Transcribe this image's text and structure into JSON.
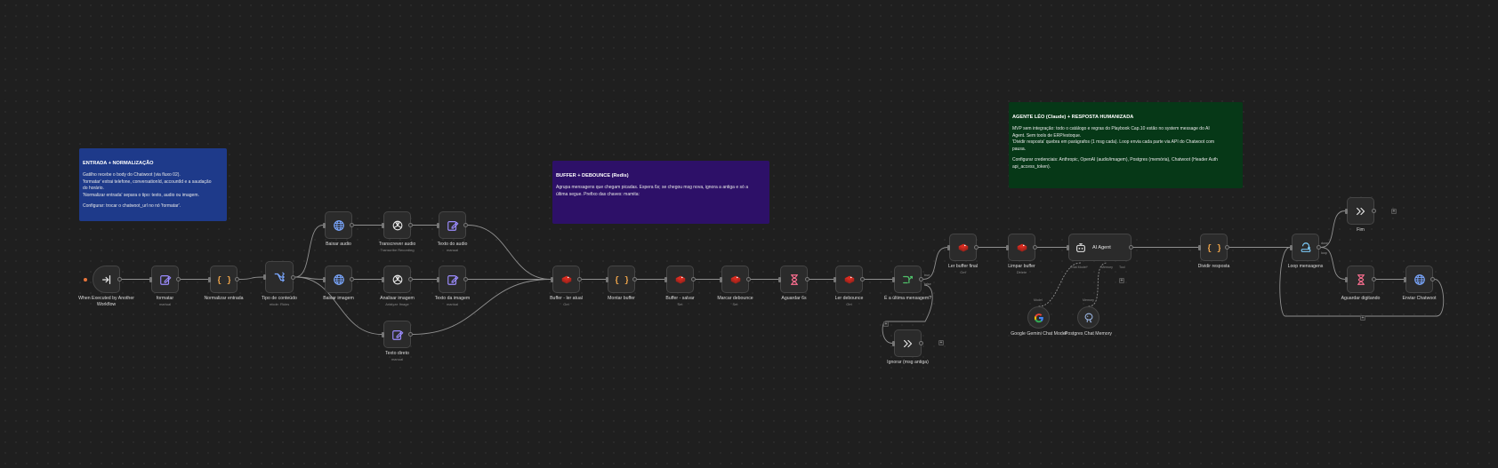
{
  "colors": {
    "background": "#1f1f1f",
    "node_bg": "#2b2b2b",
    "node_border": "#454545",
    "edge": "#8f8f8f",
    "sticky_blue": "#1e3a8a",
    "sticky_purple": "#2d1068",
    "sticky_green": "#063817",
    "redis_red": "#d82c20",
    "http_blue": "#7aa7ff",
    "code_orange": "#f0a54a",
    "edit_purple": "#9c8cff",
    "wait_pink": "#ff6f91",
    "if_green": "#4fc26a",
    "trigger_orange": "#e8743b"
  },
  "stickies": [
    {
      "id": "st_entrada",
      "title": "ENTRADA + NORMALIZAÇÃO",
      "color": "#1e3a8a",
      "lines": [
        "Gatilho recebe o body do Chatwoot (via fluxo 02).",
        "'formatar' extrai telefone, conversationId, accountId e a saudação",
        "do horário.",
        "'Normalizar entrada' separa o tipo: texto, audio ou imagem.",
        "",
        "Configurar: trocar o chatwoot_url no nó 'formatar'."
      ]
    },
    {
      "id": "st_buffer",
      "title": "BUFFER + DEBOUNCE (Redis)",
      "color": "#2d1068",
      "lines": [
        "Agrupa mensagens que chegam picadas. Espera 6s; se chegou msg nova, ignora a antiga e só a",
        "última segue. Prefixo das chaves: mamita:"
      ]
    },
    {
      "id": "st_agente",
      "title": "AGENTE LÉO (Claude) + RESPOSTA HUMANIZADA",
      "color": "#063817",
      "lines": [
        "MVP sem integração: todo o catálogo e regras do Playbook Cap.10 estão no system message do AI",
        "Agent. Sem tools de ERP/estoque.",
        "'Dividir resposta' quebra em parágrafos (1 msg cada). Loop envia cada parte via API do Chatwoot com",
        "pausa.",
        "",
        "Configurar credenciais: Anthropic, OpenAI (audio/imagem), Postgres (memória), Chatwoot (Header Auth",
        "api_access_token)."
      ]
    }
  ],
  "nodes": [
    {
      "id": "n_trigger",
      "label": "When Executed by Another Workflow",
      "sub": "",
      "icon": "trigger-icon"
    },
    {
      "id": "n_formatar",
      "label": "formatar",
      "sub": "manual",
      "icon": "edit-icon"
    },
    {
      "id": "n_normalizar",
      "label": "Normalizar entrada",
      "sub": "",
      "icon": "code-icon"
    },
    {
      "id": "n_tipo",
      "label": "Tipo de conteúdo",
      "sub": "mode: Rules",
      "icon": "switch-icon"
    },
    {
      "id": "n_baixar_audio",
      "label": "Baixar audio",
      "sub": "",
      "icon": "globe-icon"
    },
    {
      "id": "n_transcrever",
      "label": "Transcrever audio",
      "sub": "Transcribe Recording",
      "icon": "openai-icon"
    },
    {
      "id": "n_texto_audio",
      "label": "Texto do audio",
      "sub": "manual",
      "icon": "edit-icon"
    },
    {
      "id": "n_baixar_imagem",
      "label": "Baixar imagem",
      "sub": "",
      "icon": "globe-icon"
    },
    {
      "id": "n_analisar",
      "label": "Analisar imagem",
      "sub": "Analyze Image",
      "icon": "openai-icon"
    },
    {
      "id": "n_texto_imagem",
      "label": "Texto da imagem",
      "sub": "manual",
      "icon": "edit-icon"
    },
    {
      "id": "n_texto_direto",
      "label": "Texto direto",
      "sub": "manual",
      "icon": "edit-icon"
    },
    {
      "id": "n_buffer_atual",
      "label": "Buffer - ler atual",
      "sub": "Get",
      "icon": "redis-icon"
    },
    {
      "id": "n_montar",
      "label": "Montar buffer",
      "sub": "",
      "icon": "code-icon"
    },
    {
      "id": "n_buffer_salvar",
      "label": "Buffer - salvar",
      "sub": "Set",
      "icon": "redis-icon"
    },
    {
      "id": "n_marcar",
      "label": "Marcar debounce",
      "sub": "Set",
      "icon": "redis-icon"
    },
    {
      "id": "n_aguardar6",
      "label": "Aguardar 6s",
      "sub": "",
      "icon": "hourglass-icon"
    },
    {
      "id": "n_ler_debounce",
      "label": "Ler debounce",
      "sub": "Get",
      "icon": "redis-icon"
    },
    {
      "id": "n_ultima",
      "label": "É a última mensagem?",
      "sub": "",
      "icon": "if-icon"
    },
    {
      "id": "n_ignorar",
      "label": "Ignorar (msg antiga)",
      "sub": "",
      "icon": "noop-icon"
    },
    {
      "id": "n_ler_final",
      "label": "Ler buffer final",
      "sub": "Get",
      "icon": "redis-icon"
    },
    {
      "id": "n_limpar",
      "label": "Limpar buffer",
      "sub": "Delete",
      "icon": "redis-icon"
    },
    {
      "id": "n_agent",
      "label": "AI Agent",
      "sub": "",
      "icon": "robot-icon"
    },
    {
      "id": "n_gemini",
      "label": "Google Gemini Chat Model",
      "sub": "",
      "icon": "google-icon"
    },
    {
      "id": "n_postgres",
      "label": "Postgres Chat Memory",
      "sub": "",
      "icon": "postgres-icon"
    },
    {
      "id": "n_dividir",
      "label": "Dividir resposta",
      "sub": "",
      "icon": "code-icon"
    },
    {
      "id": "n_loop",
      "label": "Loop mensagens",
      "sub": "",
      "icon": "loop-icon"
    },
    {
      "id": "n_fim",
      "label": "Fim",
      "sub": "",
      "icon": "noop-icon"
    },
    {
      "id": "n_aguardar_dig",
      "label": "Aguardar digitando",
      "sub": "",
      "icon": "hourglass-icon"
    },
    {
      "id": "n_enviar",
      "label": "Enviar Chatwoot",
      "sub": "",
      "icon": "globe-icon"
    }
  ],
  "port_labels": {
    "chat_model": "Chat Model*",
    "memory": "Memory",
    "tool": "Tool",
    "model": "Model",
    "memory_top": "Memory"
  },
  "branch_labels": {
    "true": "true",
    "false": "false",
    "done": "done",
    "loop": "loop"
  }
}
